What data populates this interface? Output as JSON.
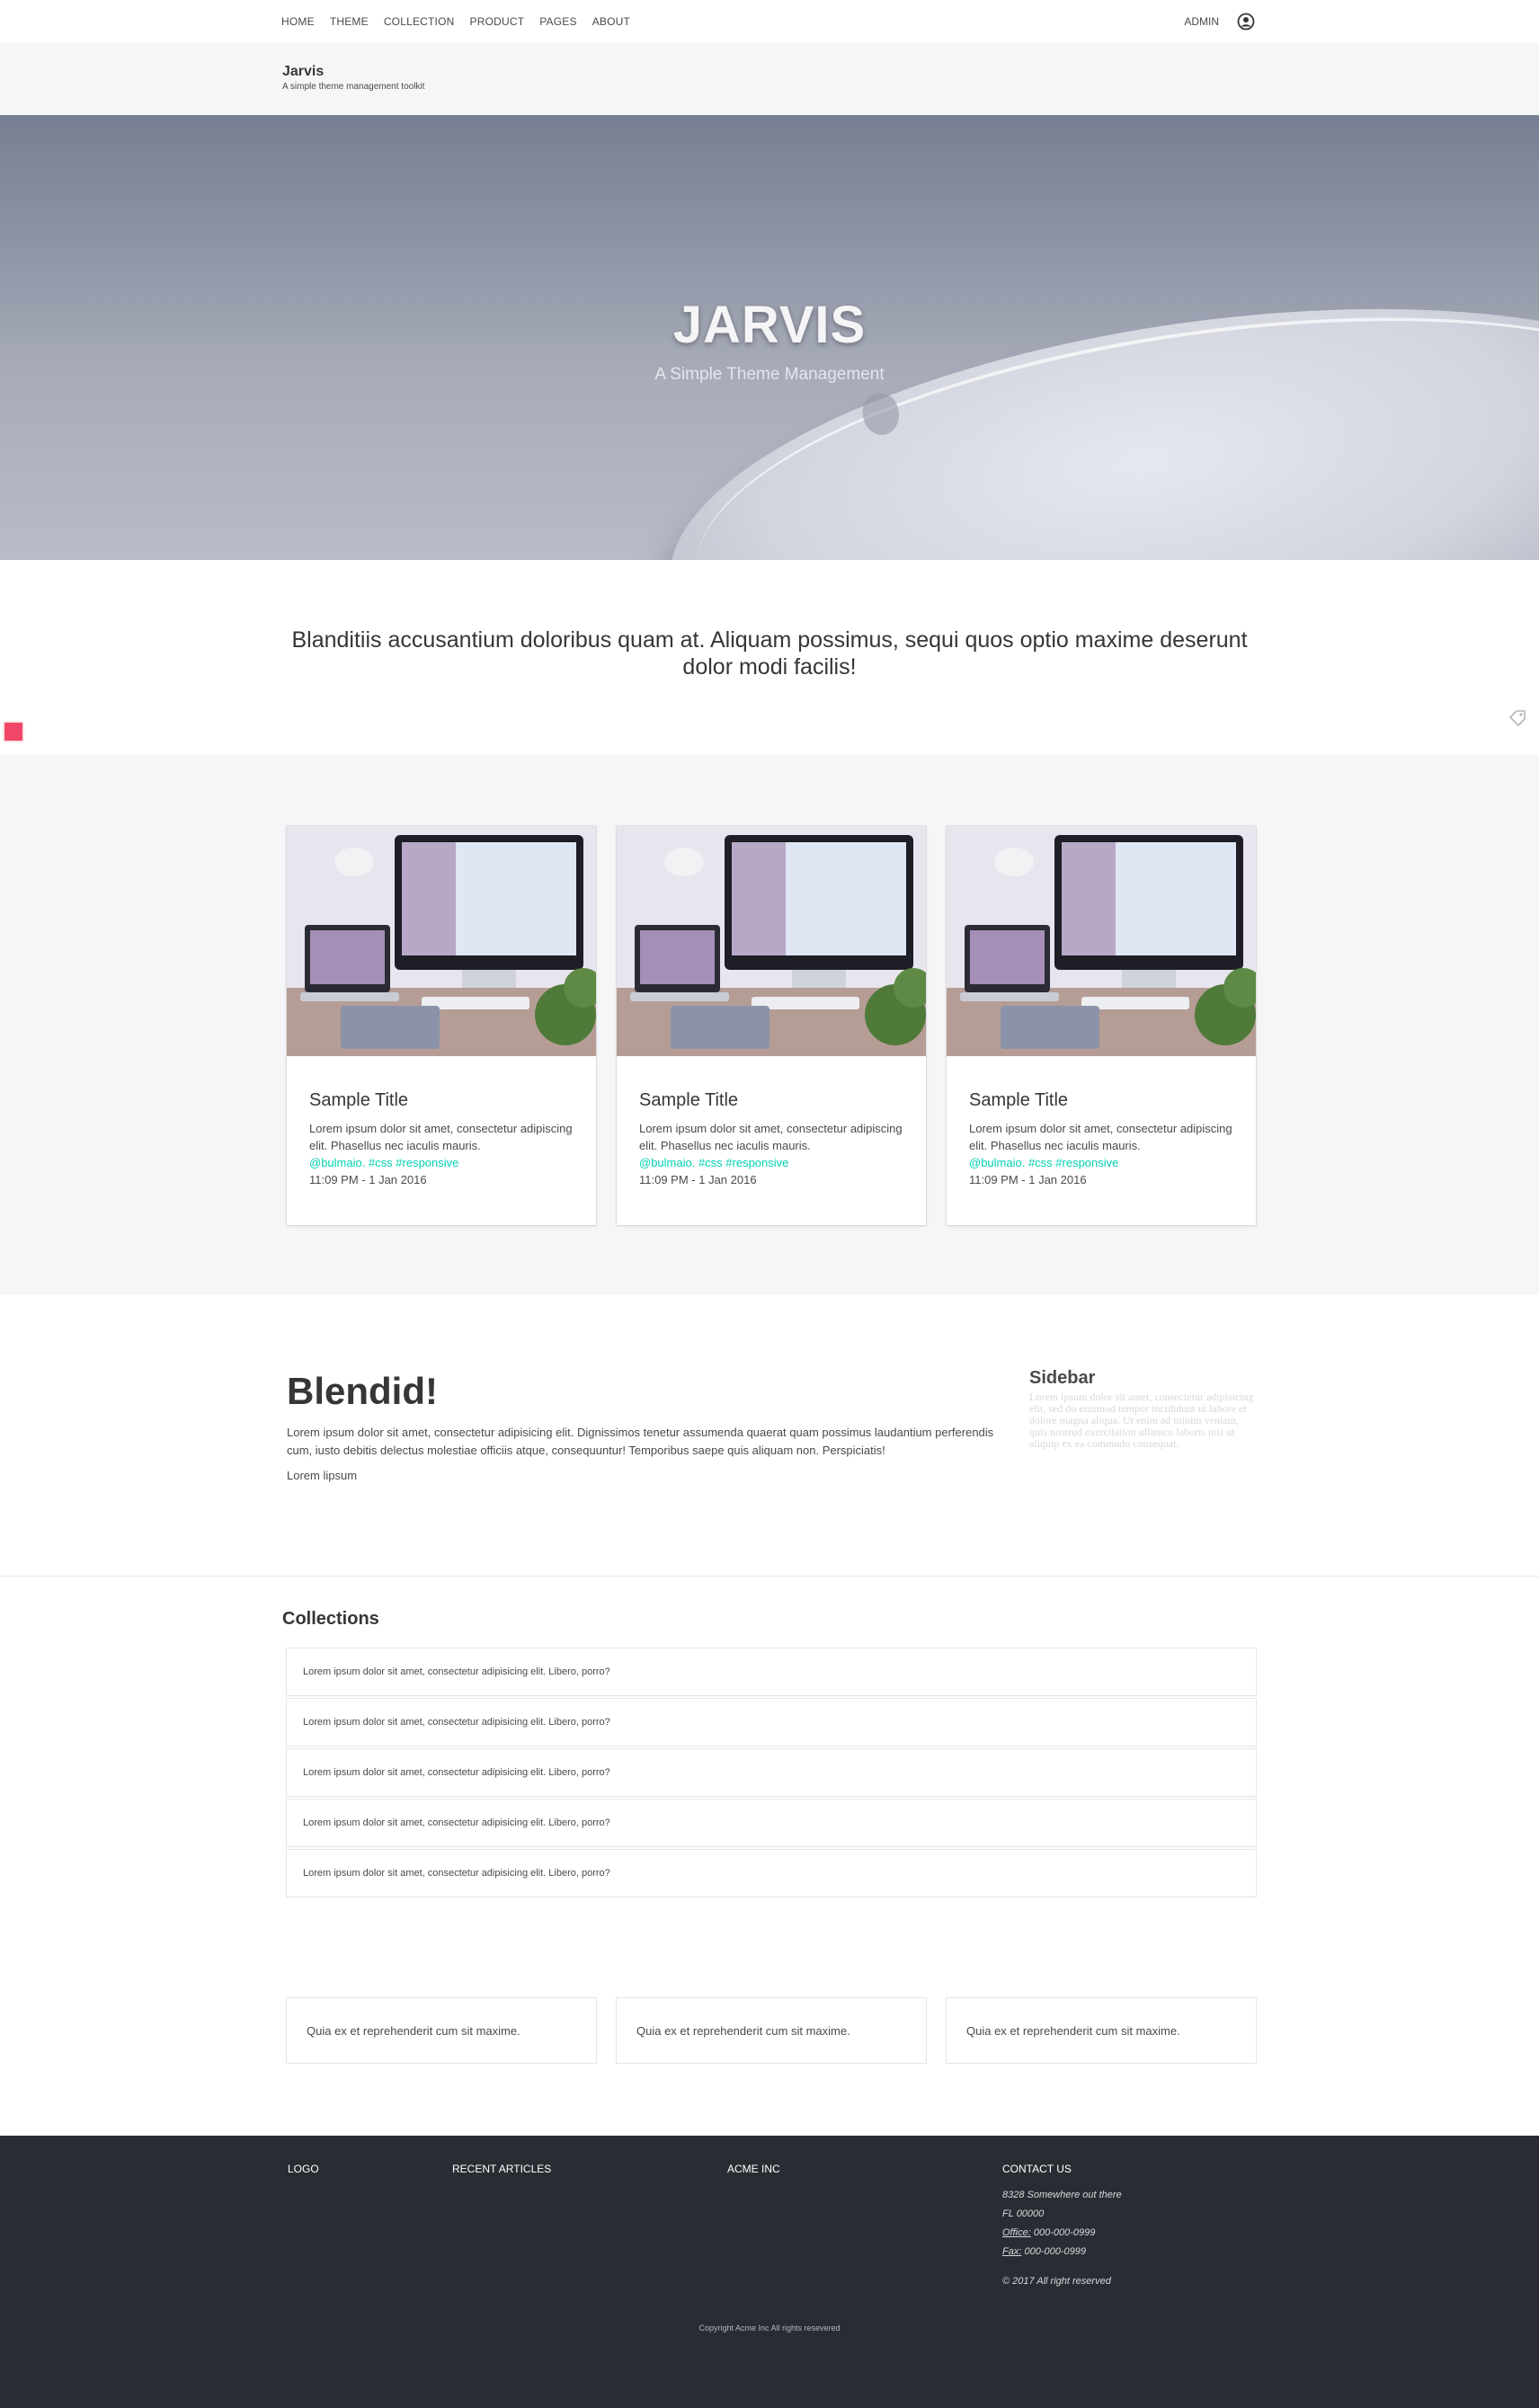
{
  "nav": {
    "items": [
      "HOME",
      "THEME",
      "COLLECTION",
      "PRODUCT",
      "PAGES",
      "ABOUT"
    ],
    "admin": "ADMIN",
    "user_icon": "user-circle-icon"
  },
  "brand": {
    "title": "Jarvis",
    "subtitle": "A simple theme management toolkit"
  },
  "hero": {
    "title": "JARVIS",
    "subtitle": "A Simple Theme Management"
  },
  "intro": {
    "text": "Blanditiis accusantium doloribus quam at. Aliquam possimus, sequi quos optio maxime deserunt dolor modi facilis!"
  },
  "cards": [
    {
      "title": "Sample Title",
      "text": "Lorem ipsum dolor sit amet, consectetur adipiscing elit. Phasellus nec iaculis mauris.",
      "tags": "@bulmaio. #css #responsive",
      "date": "11:09 PM - 1 Jan 2016"
    },
    {
      "title": "Sample Title",
      "text": "Lorem ipsum dolor sit amet, consectetur adipiscing elit. Phasellus nec iaculis mauris.",
      "tags": "@bulmaio. #css #responsive",
      "date": "11:09 PM - 1 Jan 2016"
    },
    {
      "title": "Sample Title",
      "text": "Lorem ipsum dolor sit amet, consectetur adipiscing elit. Phasellus nec iaculis mauris.",
      "tags": "@bulmaio. #css #responsive",
      "date": "11:09 PM - 1 Jan 2016"
    }
  ],
  "blendid": {
    "title": "Blendid!",
    "text": "Lorem ipsum dolor sit amet, consectetur adipisicing elit. Dignissimos tenetur assumenda quaerat quam possimus laudantium perferendis cum, iusto debitis delectus molestiae officiis atque, consequuntur! Temporibus saepe quis aliquam non. Perspiciatis!",
    "link": "Lorem lipsum"
  },
  "sidebar": {
    "title": "Sidebar",
    "text": "Lorem ipsum dolor sit amet, consectetur adipisicing elit, sed do eiusmod tempor incididunt ut labore et dolore magna aliqua. Ut enim ad minim veniam, quis nostrud exercitation ullamco laboris nisi ut aliquip ex ea commodo consequat."
  },
  "collections": {
    "title": "Collections",
    "items": [
      "Lorem ipsum dolor sit amet, consectetur adipisicing elit. Libero, porro?",
      "Lorem ipsum dolor sit amet, consectetur adipisicing elit. Libero, porro?",
      "Lorem ipsum dolor sit amet, consectetur adipisicing elit. Libero, porro?",
      "Lorem ipsum dolor sit amet, consectetur adipisicing elit. Libero, porro?",
      "Lorem ipsum dolor sit amet, consectetur adipisicing elit. Libero, porro?"
    ]
  },
  "boxes": [
    "Quia ex et reprehenderit cum sit maxime.",
    "Quia ex et reprehenderit cum sit maxime.",
    "Quia ex et reprehenderit cum sit maxime."
  ],
  "footer": {
    "logo": "LOGO",
    "recent": "RECENT ARTICLES",
    "acme": "ACME INC",
    "contact": "CONTACT US",
    "address1": "8328 Somewhere out there",
    "address2": "FL 00000",
    "office_label": "Office:",
    "office": "000-000-0999",
    "fax_label": "Fax:",
    "fax": "000-000-0999",
    "rights": "© 2017 All right reserved",
    "copyright": "Copyright Acme Inc All rights resevered"
  },
  "colors": {
    "accent": "#00d1b2",
    "footer_bg": "#292d33",
    "section_bg": "#f4f6f8"
  }
}
